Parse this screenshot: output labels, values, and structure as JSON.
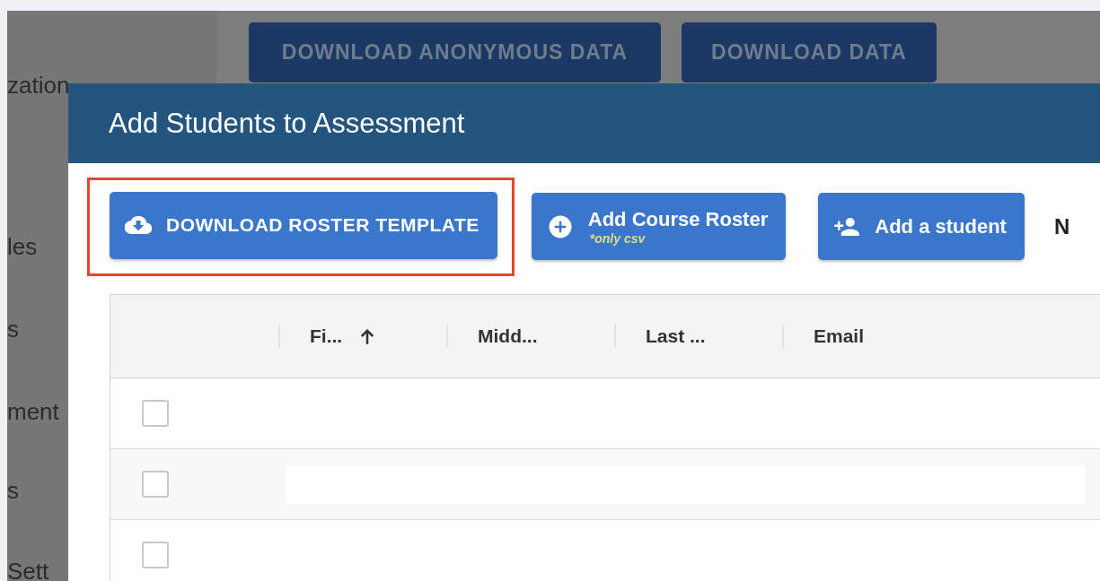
{
  "background": {
    "sidebar_items": [
      "zation",
      "les",
      "s",
      "ment",
      "s",
      "Sett"
    ],
    "buttons": [
      "DOWNLOAD ANONYMOUS DATA",
      "DOWNLOAD DATA"
    ]
  },
  "dialog": {
    "title": "Add Students to Assessment",
    "actions": [
      {
        "kind": "download",
        "label": "DOWNLOAD ROSTER TEMPLATE",
        "highlighted": true
      },
      {
        "kind": "upload",
        "label": "Add Course Roster",
        "note": "*only csv",
        "highlighted": false
      },
      {
        "kind": "add-person",
        "label": "Add a student",
        "highlighted": false
      }
    ],
    "cut_text": "N",
    "table": {
      "columns": [
        {
          "label": "Fi...",
          "sorted": true
        },
        {
          "label": "Midd...",
          "sorted": false
        },
        {
          "label": "Last ...",
          "sorted": false
        },
        {
          "label": "Email",
          "sorted": false
        }
      ],
      "rows": [
        {
          "checked": false,
          "loading": false
        },
        {
          "checked": false,
          "loading": true
        },
        {
          "checked": false,
          "loading": false
        }
      ]
    }
  }
}
